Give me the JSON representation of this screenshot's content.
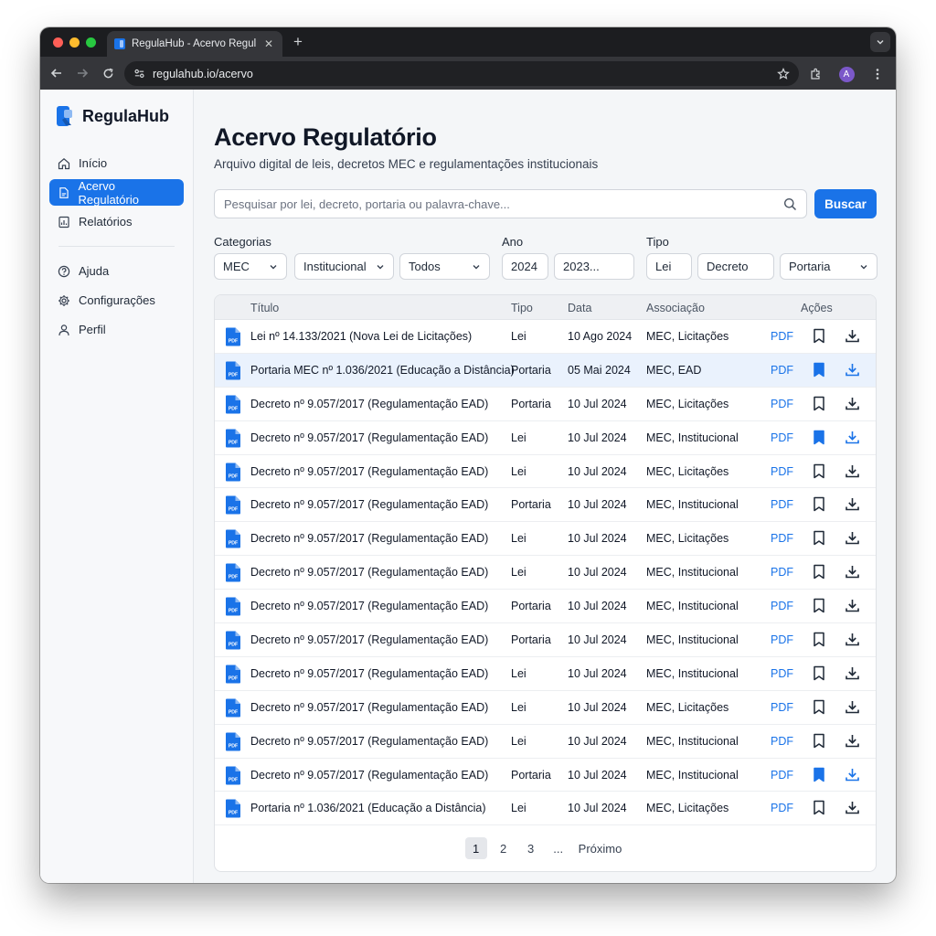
{
  "browser": {
    "tab_title": "RegulaHub - Acervo Regulatório",
    "url": "regulahub.io/acervo",
    "profile_initial": "A"
  },
  "colors": {
    "accent": "#1a73e8",
    "text": "#111827"
  },
  "sidebar": {
    "brand": "RegulaHub",
    "items": [
      {
        "label": "Início",
        "icon": "home-icon"
      },
      {
        "label": "Acervo Regulatório",
        "icon": "document-icon",
        "active": true
      },
      {
        "label": "Relatórios",
        "icon": "report-icon"
      }
    ],
    "secondary": [
      {
        "label": "Ajuda",
        "icon": "help-icon"
      },
      {
        "label": "Configurações",
        "icon": "gear-icon"
      },
      {
        "label": "Perfil",
        "icon": "user-icon"
      }
    ]
  },
  "main": {
    "title": "Acervo Regulatório",
    "subtitle": "Arquivo digital de leis, decretos MEC e regulamentações institucionais",
    "search": {
      "placeholder": "Pesquisar por lei, decreto, portaria ou palavra-chave...",
      "button": "Buscar"
    },
    "filters": {
      "categorias_label": "Categorias",
      "ano_label": "Ano",
      "tipo_label": "Tipo",
      "categoria_1": "MEC",
      "categoria_2": "Institucional",
      "categoria_3": "Todos",
      "ano_1": "2024",
      "ano_2": "2023...",
      "tipo_1": "Lei",
      "tipo_2": "Decreto",
      "tipo_3": "Portaria"
    },
    "table": {
      "headers": {
        "titulo": "Título",
        "tipo": "Tipo",
        "data": "Data",
        "associacao": "Associação",
        "acoes": "Ações"
      },
      "pdf_label": "PDF",
      "rows": [
        {
          "titulo": "Lei nº 14.133/2021 (Nova Lei de Licitações)",
          "tipo": "Lei",
          "data": "10 Ago 2024",
          "associacao": "MEC, Licitações",
          "saved": false
        },
        {
          "titulo": "Portaria MEC nº 1.036/2021 (Educação a Distância)",
          "tipo": "Portaria",
          "data": "05 Mai 2024",
          "associacao": "MEC, EAD",
          "saved": true,
          "selected": true
        },
        {
          "titulo": "Decreto nº 9.057/2017 (Regulamentação EAD)",
          "tipo": "Portaria",
          "data": "10 Jul 2024",
          "associacao": "MEC, Licitações",
          "saved": false
        },
        {
          "titulo": "Decreto nº 9.057/2017 (Regulamentação EAD)",
          "tipo": "Lei",
          "data": "10 Jul 2024",
          "associacao": "MEC, Institucional",
          "saved": true
        },
        {
          "titulo": "Decreto nº 9.057/2017 (Regulamentação EAD)",
          "tipo": "Lei",
          "data": "10 Jul 2024",
          "associacao": "MEC, Licitações",
          "saved": false
        },
        {
          "titulo": "Decreto nº 9.057/2017 (Regulamentação EAD)",
          "tipo": "Portaria",
          "data": "10 Jul 2024",
          "associacao": "MEC, Institucional",
          "saved": false
        },
        {
          "titulo": "Decreto nº 9.057/2017 (Regulamentação EAD)",
          "tipo": "Lei",
          "data": "10 Jul 2024",
          "associacao": "MEC, Licitações",
          "saved": false
        },
        {
          "titulo": "Decreto nº 9.057/2017 (Regulamentação EAD)",
          "tipo": "Lei",
          "data": "10 Jul 2024",
          "associacao": "MEC, Institucional",
          "saved": false
        },
        {
          "titulo": "Decreto nº 9.057/2017 (Regulamentação EAD)",
          "tipo": "Portaria",
          "data": "10 Jul 2024",
          "associacao": "MEC, Institucional",
          "saved": false
        },
        {
          "titulo": "Decreto nº 9.057/2017 (Regulamentação EAD)",
          "tipo": "Portaria",
          "data": "10 Jul 2024",
          "associacao": "MEC, Institucional",
          "saved": false
        },
        {
          "titulo": "Decreto nº 9.057/2017 (Regulamentação EAD)",
          "tipo": "Lei",
          "data": "10 Jul 2024",
          "associacao": "MEC, Institucional",
          "saved": false
        },
        {
          "titulo": "Decreto nº 9.057/2017 (Regulamentação EAD)",
          "tipo": "Lei",
          "data": "10 Jul 2024",
          "associacao": "MEC, Licitações",
          "saved": false
        },
        {
          "titulo": "Decreto nº 9.057/2017 (Regulamentação EAD)",
          "tipo": "Lei",
          "data": "10 Jul 2024",
          "associacao": "MEC, Institucional",
          "saved": false
        },
        {
          "titulo": "Decreto nº 9.057/2017 (Regulamentação EAD)",
          "tipo": "Portaria",
          "data": "10 Jul 2024",
          "associacao": "MEC, Institucional",
          "saved": true
        },
        {
          "titulo": "Portaria nº 1.036/2021 (Educação a Distância)",
          "tipo": "Lei",
          "data": "10 Jul 2024",
          "associacao": "MEC, Licitações",
          "saved": false
        }
      ]
    },
    "pagination": {
      "pages": [
        "1",
        "2",
        "3"
      ],
      "current": "1",
      "ellipsis": "...",
      "next": "Próximo"
    }
  }
}
